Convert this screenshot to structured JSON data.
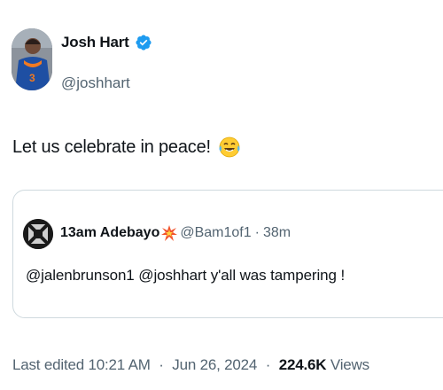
{
  "author": {
    "display_name": "Josh Hart",
    "handle": "@joshhart",
    "verified_icon": "verified-badge-icon",
    "jersey_number": "3"
  },
  "tweet": {
    "text": "Let us celebrate in peace!",
    "emoji_icon": "face-with-tears-of-joy-icon"
  },
  "quote": {
    "display_name": "13am Adebayo",
    "name_emoji_icon": "collision-icon",
    "handle": "@Bam1of1",
    "separator": "·",
    "time": "38m",
    "text": "@jalenbrunson1 @joshhart  y'all was tampering !"
  },
  "meta": {
    "edited_label": "Last edited",
    "time": "10:21 AM",
    "date": "Jun 26, 2024",
    "separator": "·",
    "views_count": "224.6K",
    "views_label": "Views"
  },
  "colors": {
    "verified_blue": "#1d9bf0",
    "secondary_text": "#536471",
    "primary_text": "#0f1419",
    "border": "#cfd9de"
  }
}
